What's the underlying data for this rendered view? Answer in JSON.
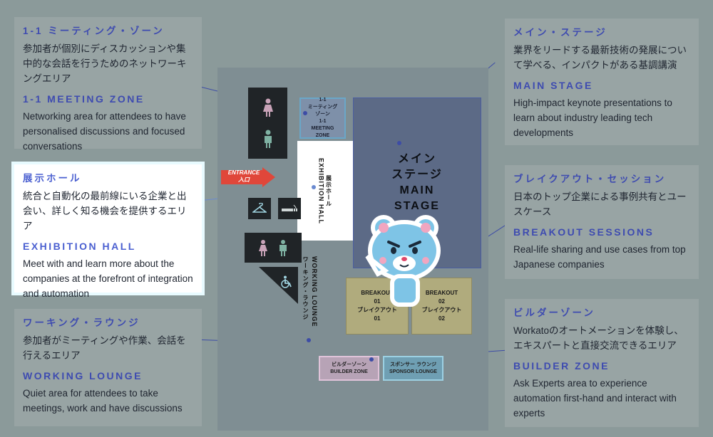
{
  "panels": {
    "meeting_zone": {
      "ja_title": "1-1 ミーティング・ゾーン",
      "ja_body": "参加者が個別にディスカッションや集中的な会話を行うためのネットワーキングエリア",
      "en_title": "1-1 MEETING ZONE",
      "en_body": "Networking area for attendees to have personalised discussions and focused conversations"
    },
    "exhibition_hall": {
      "ja_title": "展示ホール",
      "ja_body": "統合と自動化の最前線にいる企業と出会い、詳しく知る機会を提供するエリア",
      "en_title": "EXHIBITION HALL",
      "en_body": "Meet with and learn more about the companies at the forefront of integration and automation"
    },
    "working_lounge": {
      "ja_title": "ワーキング・ラウンジ",
      "ja_body": "参加者がミーティングや作業、会話を行えるエリア",
      "en_title": "WORKING LOUNGE",
      "en_body": "Quiet area for attendees to take meetings, work and have discussions"
    },
    "main_stage": {
      "ja_title": "メイン・ステージ",
      "ja_body": "業界をリードする最新技術の発展について学べる、インパクトがある基調講演",
      "en_title": "MAIN STAGE",
      "en_body": "High-impact keynote presentations to learn about industry leading tech developments"
    },
    "breakout": {
      "ja_title": "ブレイクアウト・セッション",
      "ja_body": "日本のトップ企業による事例共有とユースケース",
      "en_title": "BREAKOUT SESSIONS",
      "en_body": "Real-life sharing and use cases from top Japanese companies"
    },
    "builder_zone": {
      "ja_title": "ビルダーゾーン",
      "ja_body": "Workatoのオートメーションを体験し、エキスパートと直接交流できるエリア",
      "en_title": "BUILDER ZONE",
      "en_body": "Ask Experts area to experience automation first-hand and interact with experts"
    }
  },
  "map": {
    "entrance": {
      "en": "ENTRANCE",
      "ja": "入口"
    },
    "meeting_zone": {
      "l1": "1-1",
      "l2": "ミーティング",
      "l3": "ゾーン",
      "l4": "1-1",
      "l5": "MEETING",
      "l6": "ZONE"
    },
    "main_stage": {
      "l1": "メイン",
      "l2": "ステージ",
      "l3": "MAIN",
      "l4": "STAGE"
    },
    "exhibition_hall": {
      "ja": "展示ホール",
      "en": "EXHIBITION HALL"
    },
    "working_lounge": {
      "ja": "ワーキング・ラウンジ",
      "en": "WORKING LOUNGE"
    },
    "breakout_01": {
      "l1": "BREAKOUT",
      "l2": "01",
      "l3": "ブレイクアウト",
      "l4": "01"
    },
    "breakout_02": {
      "l1": "BREAKOUT",
      "l2": "02",
      "l3": "ブレイクアウト",
      "l4": "02"
    },
    "builder_zone": {
      "ja": "ビルダーゾーン",
      "en": "BUILDER ZONE"
    },
    "sponsor_lounge": {
      "ja": "スポンサー ラウンジ",
      "en": "SPONSOR LOUNGE"
    }
  },
  "icons": [
    "female-restroom-icon",
    "male-restroom-icon",
    "cloakroom-icon",
    "smoking-icon",
    "wheelchair-icon",
    "mascot-bear-icon"
  ],
  "colors": {
    "accent": "#3e4bb0",
    "entrance": "#e0473a",
    "overlay": "#8b9a9a"
  }
}
